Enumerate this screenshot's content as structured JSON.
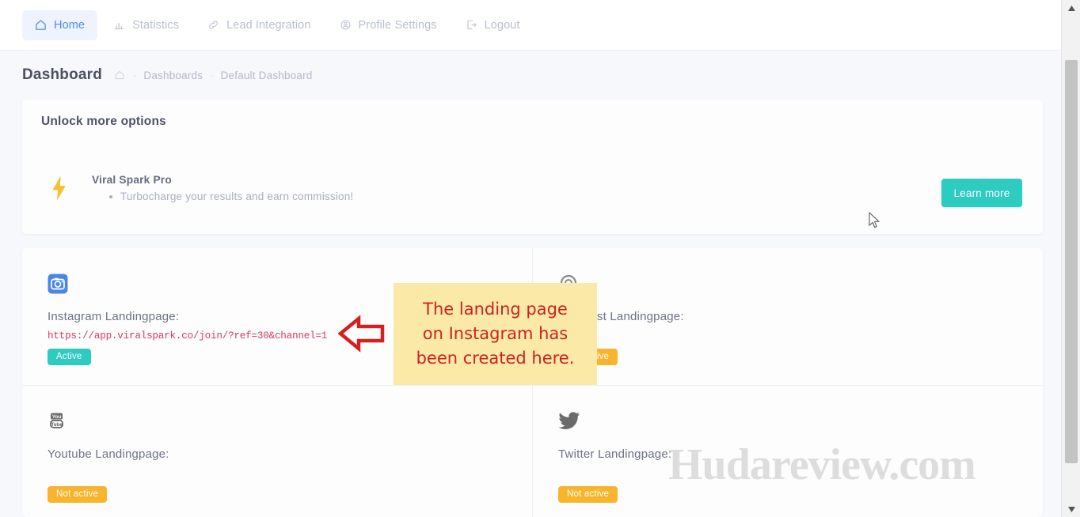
{
  "nav": {
    "items": [
      {
        "label": "Home",
        "icon": "home-icon",
        "active": true
      },
      {
        "label": "Statistics",
        "icon": "chart-icon",
        "active": false
      },
      {
        "label": "Lead Integration",
        "icon": "link-icon",
        "active": false
      },
      {
        "label": "Profile Settings",
        "icon": "user-gear-icon",
        "active": false
      },
      {
        "label": "Logout",
        "icon": "logout-icon",
        "active": false
      }
    ]
  },
  "breadcrumb": {
    "page_title": "Dashboard",
    "home_icon": "home-icon",
    "separator": "·",
    "parent": "Dashboards",
    "current": "Default Dashboard"
  },
  "promo": {
    "title": "Unlock more options",
    "icon": "lightning-bolt-icon",
    "product_name": "Viral Spark Pro",
    "bullet": "Turbocharge your results and earn commission!",
    "button_label": "Learn more",
    "button_color": "#2ecbc0"
  },
  "channels": [
    {
      "icon": "instagram-icon",
      "label": "Instagram Landingpage:",
      "url": "https://app.viralspark.co/join/?ref=30&channel=1",
      "status": "Active",
      "status_color": "#2ecbc0"
    },
    {
      "icon": "pinterest-icon",
      "label": "Pinterest Landingpage:",
      "url": "",
      "status": "Not active",
      "status_color": "#f7b42c"
    },
    {
      "icon": "youtube-icon",
      "label": "Youtube Landingpage:",
      "url": "",
      "status": "Not active",
      "status_color": "#f7b42c"
    },
    {
      "icon": "twitter-icon",
      "label": "Twitter Landingpage:",
      "url": "",
      "status": "Not active",
      "status_color": "#f7b42c"
    }
  ],
  "annotation": {
    "line1": "The landing page",
    "line2": "on Instagram has",
    "line3": "been created here.",
    "text_color": "#cc2222",
    "background_color": "#fbe9a8",
    "arrow_icon": "left-arrow-annotation"
  },
  "watermark": {
    "text": "Hudareview.com"
  },
  "scrollbar": {
    "up_icon": "scroll-up-arrow",
    "down_icon": "scroll-down-arrow"
  }
}
